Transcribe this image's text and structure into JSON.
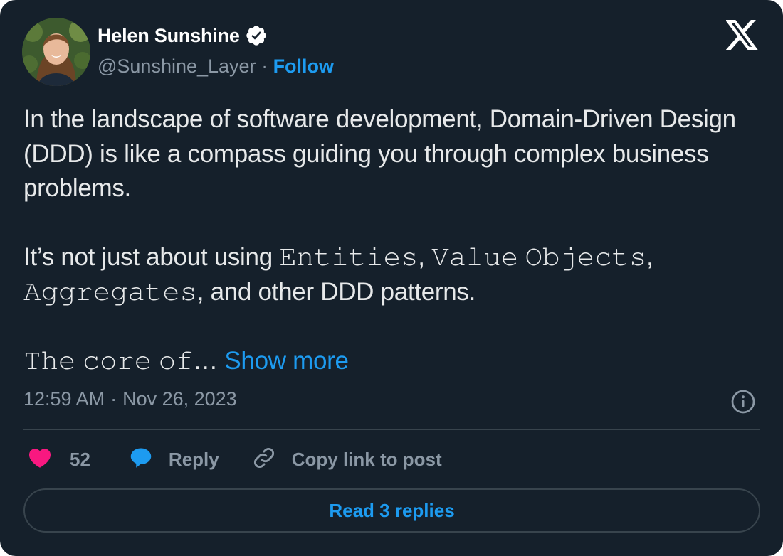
{
  "author": {
    "name": "Helen Sunshine",
    "handle": "@Sunshine_Layer",
    "follow_label": "Follow"
  },
  "post": {
    "paragraphs": [
      "In the landscape of software development, Domain-Driven Design (DDD) is like a compass guiding you through complex business problems.",
      "It’s not just about using 𝙴𝚗𝚝𝚒𝚝𝚒𝚎𝚜, 𝚅𝚊𝚕𝚞𝚎 𝙾𝚋𝚓𝚎𝚌𝚝𝚜, 𝙰𝚐𝚐𝚛𝚎𝚐𝚊𝚝𝚎𝚜, and other DDD patterns."
    ],
    "truncated_text": "𝚃𝚑𝚎 𝚌𝚘𝚛𝚎 𝚘𝚏…",
    "show_more_label": "Show more",
    "time": "12:59 AM",
    "date": "Nov 26, 2023"
  },
  "actions": {
    "likes": "52",
    "reply_label": "Reply",
    "copy_label": "Copy link to post",
    "read_replies_label": "Read 3 replies"
  },
  "colors": {
    "background": "#15202b",
    "accent": "#1d9bf0",
    "like": "#f91880",
    "text": "#e7e9ea",
    "muted": "#8b98a5"
  },
  "icons": [
    "verified-badge-icon",
    "x-logo-icon",
    "info-icon",
    "heart-icon",
    "reply-bubble-icon",
    "link-icon"
  ]
}
